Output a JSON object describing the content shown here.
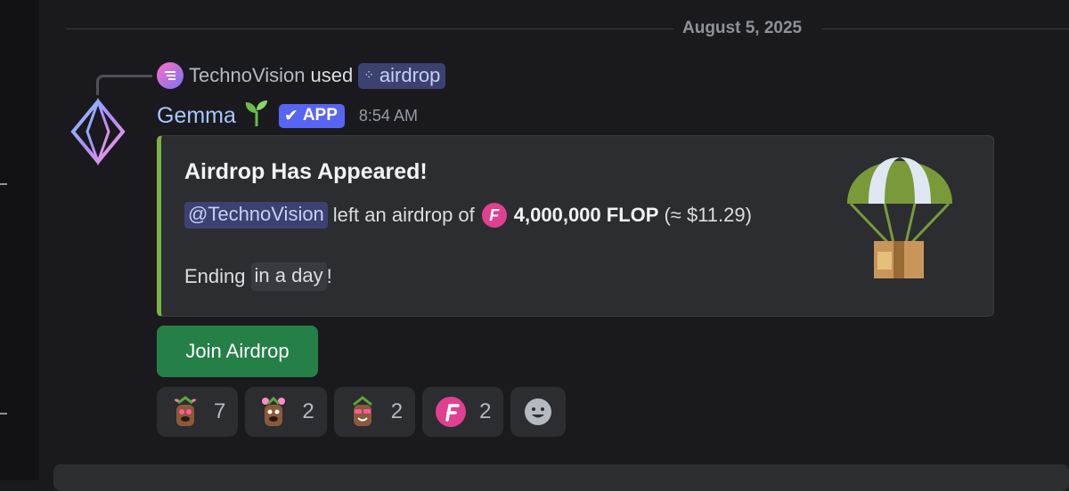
{
  "date_divider": "August 5, 2025",
  "reference": {
    "username": "TechnoVision",
    "used_text": "used",
    "command": "airdrop"
  },
  "message": {
    "author": "Gemma",
    "badge": "APP",
    "timestamp": "8:54 AM"
  },
  "embed": {
    "title": "Airdrop Has Appeared!",
    "mention": "@TechnoVision",
    "left_text": "left an airdrop of",
    "amount": "4,000,000 FLOP",
    "converted": "(≈ $11.29)",
    "ending_prefix": "Ending",
    "ending_code": "in a day",
    "ending_suffix": "!",
    "accent_color": "#7cb342"
  },
  "join_button": {
    "label": "Join Airdrop",
    "color": "#248046"
  },
  "reactions": [
    {
      "icon": "plant-hearts-emoji",
      "count": "7"
    },
    {
      "icon": "plant-flowers-emoji",
      "count": "2"
    },
    {
      "icon": "plant-sunglasses-emoji",
      "count": "2"
    },
    {
      "icon": "flop-coin-emoji",
      "count": "2"
    }
  ],
  "colors": {
    "background": "#1a1a1e",
    "mention_bg": "#3c4270",
    "app_badge": "#5865f2",
    "flop": "#e0408f"
  }
}
